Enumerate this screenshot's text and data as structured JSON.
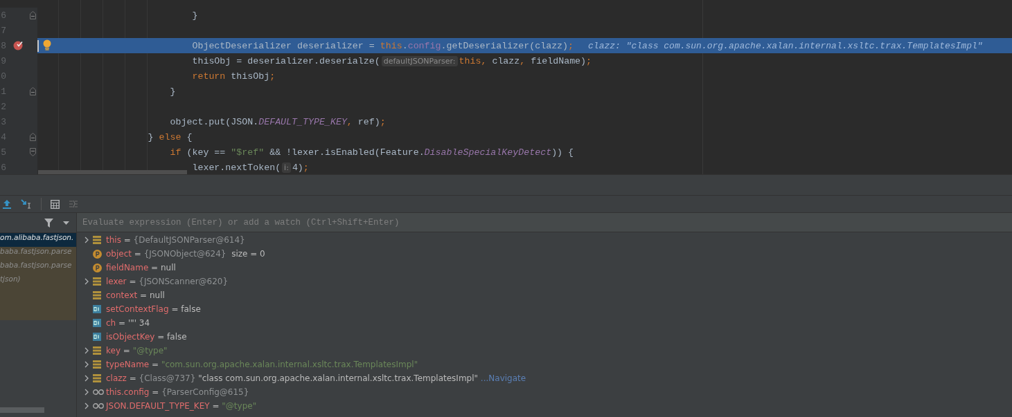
{
  "editor": {
    "lines": [
      {
        "number": "6",
        "current": false,
        "breakpoint": false,
        "fold": {
          "kind": "end"
        },
        "tokens": [
          {
            "kind": "plain",
            "text": "                            }"
          }
        ]
      },
      {
        "number": "7",
        "current": false,
        "breakpoint": false
      },
      {
        "number": "8",
        "current": true,
        "breakpoint": true,
        "tokens": [
          {
            "kind": "plain",
            "text": "                            ObjectDeserializer deserializer = "
          },
          {
            "kind": "keyword",
            "text": "this"
          },
          {
            "kind": "plain",
            "text": "."
          },
          {
            "kind": "field",
            "text": "config"
          },
          {
            "kind": "plain",
            "text": ".getDeserializer(clazz)"
          },
          {
            "kind": "keyword",
            "text": ";"
          }
        ],
        "inline_value": "clazz: \"class com.sun.org.apache.xalan.internal.xsltc.trax.TemplatesImpl\""
      },
      {
        "number": "9",
        "current": false,
        "breakpoint": false,
        "tokens": [
          {
            "kind": "plain",
            "text": "                            thisObj = deserializer.deserialze("
          },
          {
            "kind": "hint",
            "text": "defaultJSONParser:"
          },
          {
            "kind": "keyword",
            "text": "this"
          },
          {
            "kind": "keyword",
            "text": ","
          },
          {
            "kind": "plain",
            "text": " clazz"
          },
          {
            "kind": "keyword",
            "text": ","
          },
          {
            "kind": "plain",
            "text": " fieldName)"
          },
          {
            "kind": "keyword",
            "text": ";"
          }
        ]
      },
      {
        "number": "0",
        "current": false,
        "breakpoint": false,
        "tokens": [
          {
            "kind": "keyword",
            "text": "                            return"
          },
          {
            "kind": "plain",
            "text": " thisObj"
          },
          {
            "kind": "keyword",
            "text": ";"
          }
        ]
      },
      {
        "number": "1",
        "current": false,
        "breakpoint": false,
        "fold": {
          "kind": "end"
        },
        "tokens": [
          {
            "kind": "plain",
            "text": "                        }"
          }
        ]
      },
      {
        "number": "2",
        "current": false,
        "breakpoint": false
      },
      {
        "number": "3",
        "current": false,
        "breakpoint": false,
        "tokens": [
          {
            "kind": "plain",
            "text": "                        object.put(JSON."
          },
          {
            "kind": "static",
            "text": "DEFAULT_TYPE_KEY"
          },
          {
            "kind": "keyword",
            "text": ","
          },
          {
            "kind": "plain",
            "text": " ref)"
          },
          {
            "kind": "keyword",
            "text": ";"
          }
        ]
      },
      {
        "number": "4",
        "current": false,
        "breakpoint": false,
        "fold": {
          "kind": "end"
        },
        "tokens": [
          {
            "kind": "plain",
            "text": "                    } "
          },
          {
            "kind": "keyword",
            "text": "else"
          },
          {
            "kind": "plain",
            "text": " {"
          }
        ]
      },
      {
        "number": "5",
        "current": false,
        "breakpoint": false,
        "fold": {
          "kind": "start"
        },
        "tokens": [
          {
            "kind": "keyword",
            "text": "                        if"
          },
          {
            "kind": "plain",
            "text": " (key == "
          },
          {
            "kind": "string",
            "text": "\"$ref\""
          },
          {
            "kind": "plain",
            "text": " && !lexer.isEnabled(Feature."
          },
          {
            "kind": "static",
            "text": "DisableSpecialKeyDetect"
          },
          {
            "kind": "plain",
            "text": ")) {"
          }
        ]
      },
      {
        "number": "6",
        "current": false,
        "breakpoint": false,
        "tokens": [
          {
            "kind": "plain",
            "text": "                            lexer.nextToken("
          },
          {
            "kind": "hint",
            "text": "i:"
          },
          {
            "kind": "plain",
            "text": "4)"
          },
          {
            "kind": "keyword",
            "text": ";"
          }
        ]
      }
    ]
  },
  "frames": [
    {
      "text": "om.alibaba.fastjson.",
      "selected": true,
      "library": false
    },
    {
      "text": "baba.fastjson.parse",
      "selected": false,
      "library": true
    },
    {
      "text": "baba.fastjson.parse",
      "selected": false,
      "library": true
    },
    {
      "text": "tjson)",
      "selected": false,
      "library": true
    }
  ],
  "evaluate": {
    "placeholder": "Evaluate expression (Enter) or add a watch (Ctrl+Shift+Enter)"
  },
  "variables": [
    {
      "expandable": true,
      "kind": "field",
      "name": "this",
      "value": [
        {
          "kind": "plain",
          "text": " = "
        },
        {
          "kind": "ref",
          "text": "{DefaultJSONParser@614}"
        }
      ]
    },
    {
      "expandable": false,
      "kind": "param",
      "name": "object",
      "value": [
        {
          "kind": "plain",
          "text": " = "
        },
        {
          "kind": "ref",
          "text": "{JSONObject@624}"
        },
        {
          "kind": "plain",
          "text": "  size = 0"
        }
      ]
    },
    {
      "expandable": false,
      "kind": "param",
      "name": "fieldName",
      "value": [
        {
          "kind": "plain",
          "text": " = null"
        }
      ]
    },
    {
      "expandable": true,
      "kind": "field",
      "name": "lexer",
      "value": [
        {
          "kind": "plain",
          "text": " = "
        },
        {
          "kind": "ref",
          "text": "{JSONScanner@620}"
        }
      ]
    },
    {
      "expandable": false,
      "kind": "field",
      "name": "context",
      "value": [
        {
          "kind": "plain",
          "text": " = null"
        }
      ]
    },
    {
      "expandable": false,
      "kind": "primitive",
      "name": "setContextFlag",
      "value": [
        {
          "kind": "plain",
          "text": " = false"
        }
      ]
    },
    {
      "expandable": false,
      "kind": "primitive",
      "name": "ch",
      "value": [
        {
          "kind": "plain",
          "text": " = '\"' 34"
        }
      ]
    },
    {
      "expandable": false,
      "kind": "primitive",
      "name": "isObjectKey",
      "value": [
        {
          "kind": "plain",
          "text": " = false"
        }
      ]
    },
    {
      "expandable": true,
      "kind": "field",
      "name": "key",
      "value": [
        {
          "kind": "plain",
          "text": " = "
        },
        {
          "kind": "string",
          "text": "\"@type\""
        }
      ]
    },
    {
      "expandable": true,
      "kind": "field",
      "name": "typeName",
      "value": [
        {
          "kind": "plain",
          "text": " = "
        },
        {
          "kind": "string",
          "text": "\"com.sun.org.apache.xalan.internal.xsltc.trax.TemplatesImpl\""
        }
      ]
    },
    {
      "expandable": true,
      "kind": "field",
      "name": "clazz",
      "value": [
        {
          "kind": "plain",
          "text": " = "
        },
        {
          "kind": "ref",
          "text": "{Class@737}"
        },
        {
          "kind": "plain",
          "text": " \"class com.sun.org.apache.xalan.internal.xsltc.trax.TemplatesImpl\""
        },
        {
          "kind": "ellipsis",
          "text": " ..."
        }
      ],
      "link": "Navigate"
    },
    {
      "expandable": true,
      "kind": "watch",
      "name": "this.config",
      "value": [
        {
          "kind": "plain",
          "text": " = "
        },
        {
          "kind": "ref",
          "text": "{ParserConfig@615}"
        }
      ]
    },
    {
      "expandable": true,
      "kind": "watch",
      "name": "JSON.DEFAULT_TYPE_KEY",
      "value": [
        {
          "kind": "plain",
          "text": " = "
        },
        {
          "kind": "string",
          "text": "\"@type\""
        }
      ]
    }
  ]
}
